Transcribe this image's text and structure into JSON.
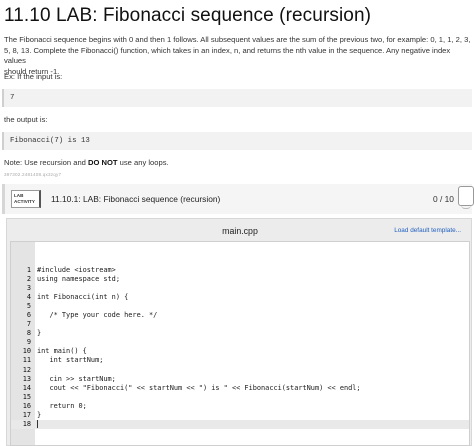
{
  "page": {
    "title": "11.10 LAB: Fibonacci sequence (recursion)",
    "intro_lines": [
      "The Fibonacci sequence begins with 0 and then 1 follows. All subsequent values are the sum of the previous two, for example: 0, 1, 1, 2, 3,",
      "5, 8, 13. Complete the Fibonacci() function, which takes in an index, n, and returns the nth value in the sequence. Any negative index values",
      "should return -1."
    ],
    "example_input_label": "Ex: If the input is:",
    "example_input": "7",
    "example_output_label": "the output is:",
    "example_output": "Fibonacci(7) is 13",
    "note_prefix": "Note: Use recursion and ",
    "note_bold": "DO NOT",
    "note_suffix": " use any loops.",
    "tiny_id": "397302.2481408.qx3zqy7"
  },
  "lab": {
    "badge_line1": "LAB",
    "badge_line2": "ACTIVITY",
    "title": "11.10.1: LAB: Fibonacci sequence (recursion)",
    "score": "0 / 10"
  },
  "editor": {
    "file_name": "main.cpp",
    "load_template_label": "Load default template...",
    "lines": [
      {
        "n": "1",
        "code": "#include <iostream>"
      },
      {
        "n": "2",
        "code": "using namespace std;"
      },
      {
        "n": "3",
        "code": ""
      },
      {
        "n": "4",
        "code": "int Fibonacci(int n) {"
      },
      {
        "n": "5",
        "code": ""
      },
      {
        "n": "6",
        "code": "   /* Type your code here. */"
      },
      {
        "n": "7",
        "code": ""
      },
      {
        "n": "8",
        "code": "}"
      },
      {
        "n": "9",
        "code": ""
      },
      {
        "n": "10",
        "code": "int main() {"
      },
      {
        "n": "11",
        "code": "   int startNum;"
      },
      {
        "n": "12",
        "code": ""
      },
      {
        "n": "13",
        "code": "   cin >> startNum;"
      },
      {
        "n": "14",
        "code": "   cout << \"Fibonacci(\" << startNum << \") is \" << Fibonacci(startNum) << endl;"
      },
      {
        "n": "15",
        "code": ""
      },
      {
        "n": "16",
        "code": "   return 0;"
      },
      {
        "n": "17",
        "code": "}"
      },
      {
        "n": "18",
        "code": ""
      }
    ]
  }
}
